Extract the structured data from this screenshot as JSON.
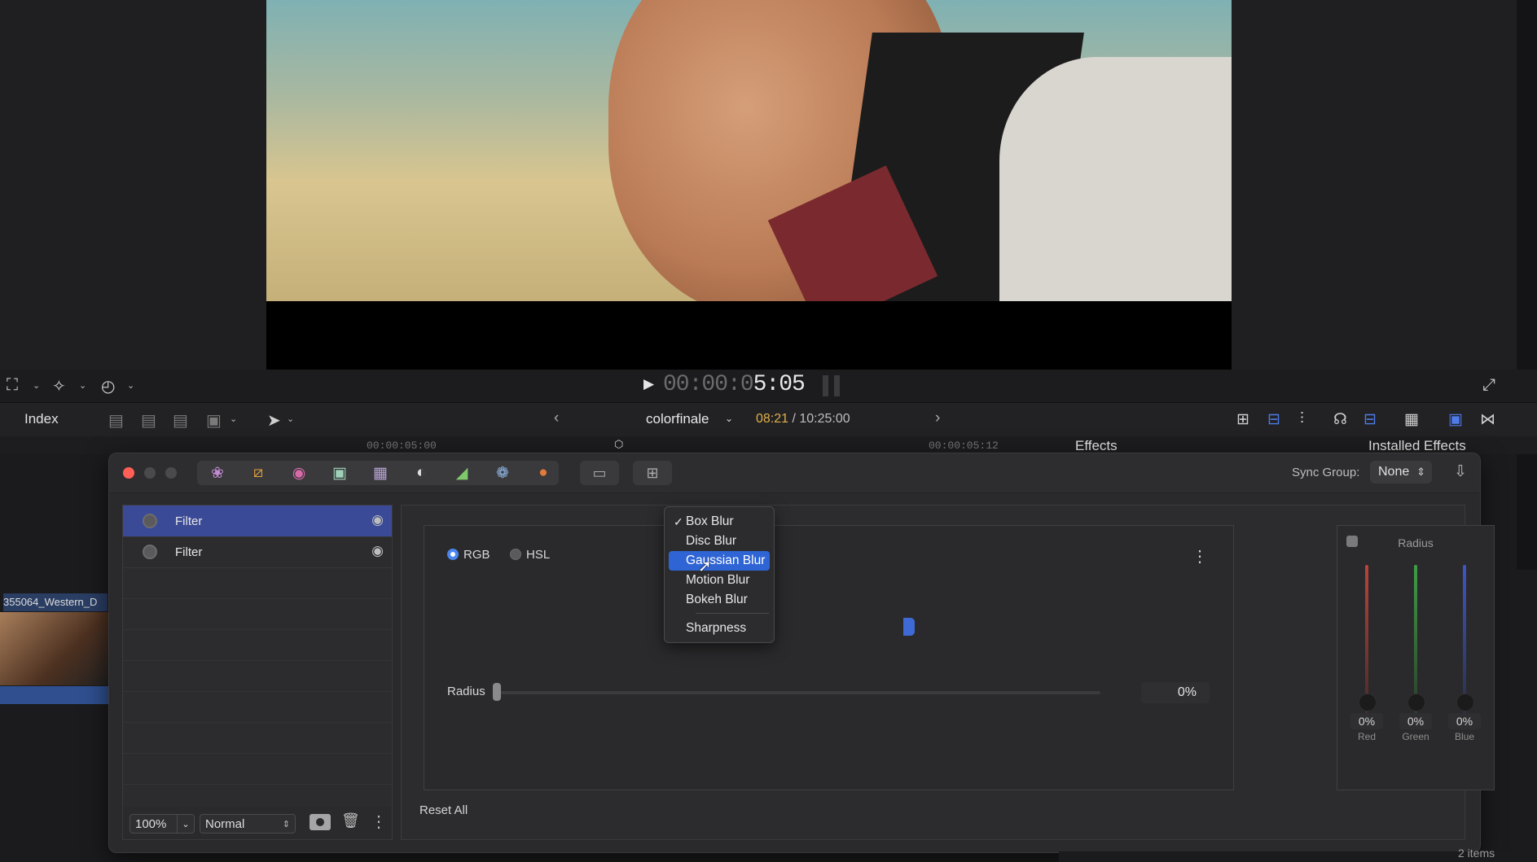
{
  "viewer": {
    "timecode_dim": "00:00:0",
    "timecode_hi": "5:05"
  },
  "timeline": {
    "index_label": "Index",
    "project_name": "colorfinale",
    "position": "08:21",
    "duration": " / 10:25:00",
    "ruler_labels": [
      "00:00:05:00",
      "00:00:05:12"
    ],
    "effects_label": "Effects",
    "installed_effects": "Installed Effects"
  },
  "clip": {
    "label": "355064_Western_D"
  },
  "plugin": {
    "sync_label": "Sync Group:",
    "sync_value": "None",
    "layers": [
      {
        "name": "Filter",
        "selected": true
      },
      {
        "name": "Filter",
        "selected": false
      }
    ],
    "zoom": "100%",
    "blend_mode": "Normal",
    "color_mode_options": [
      "RGB",
      "HSL"
    ],
    "color_mode_selected": "RGB",
    "radius_label": "Radius",
    "radius_value": "0%",
    "reset_label": "Reset All",
    "rgb_panel": {
      "title": "Radius",
      "channels": [
        {
          "name": "Red",
          "value": "0%",
          "color": "#b8443a"
        },
        {
          "name": "Green",
          "value": "0%",
          "color": "#3f9e45"
        },
        {
          "name": "Blue",
          "value": "0%",
          "color": "#3f55c4"
        }
      ]
    }
  },
  "blur_menu": {
    "items": [
      "Box Blur",
      "Disc Blur",
      "Gaussian Blur",
      "Motion Blur",
      "Bokeh Blur",
      "Sharpness"
    ],
    "checked": "Box Blur",
    "highlighted": "Gaussian Blur"
  },
  "footer": {
    "items_count": "2 items"
  },
  "accent_color": "#2f64d4"
}
